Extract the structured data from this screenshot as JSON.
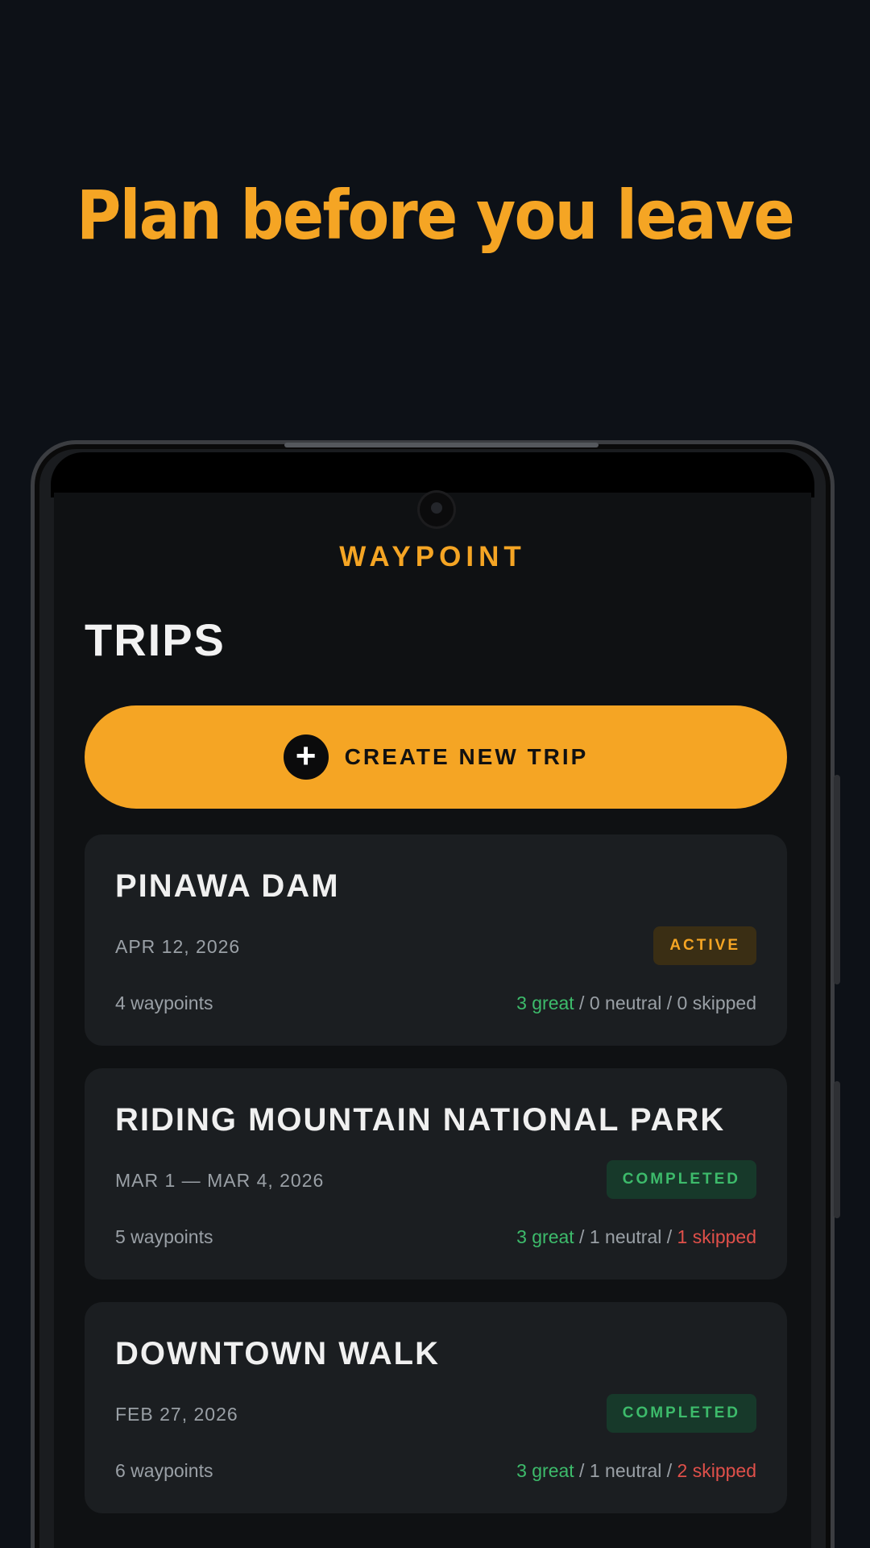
{
  "headline": "Plan before you leave",
  "app": {
    "brand": "WAYPOINT",
    "section_title": "TRIPS",
    "create_button": {
      "icon": "plus-icon",
      "label": "CREATE NEW TRIP"
    }
  },
  "trips": [
    {
      "name": "PINAWA DAM",
      "date": "APR 12, 2026",
      "status": "ACTIVE",
      "waypoints": "4 waypoints",
      "great": "3 great",
      "neutral": "0 neutral",
      "skipped": "0 skipped"
    },
    {
      "name": "RIDING MOUNTAIN NATIONAL PARK",
      "date": "MAR 1 — MAR 4, 2026",
      "status": "COMPLETED",
      "waypoints": "5 waypoints",
      "great": "3 great",
      "neutral": "1 neutral",
      "skipped": "1 skipped"
    },
    {
      "name": "DOWNTOWN WALK",
      "date": "FEB 27, 2026",
      "status": "COMPLETED",
      "waypoints": "6 waypoints",
      "great": "3 great",
      "neutral": "1 neutral",
      "skipped": "2 skipped"
    }
  ],
  "colors": {
    "accent": "#f5a524",
    "background": "#0d1117",
    "card": "#1b1e21",
    "great": "#3dbb6b",
    "skipped": "#e0504a"
  }
}
